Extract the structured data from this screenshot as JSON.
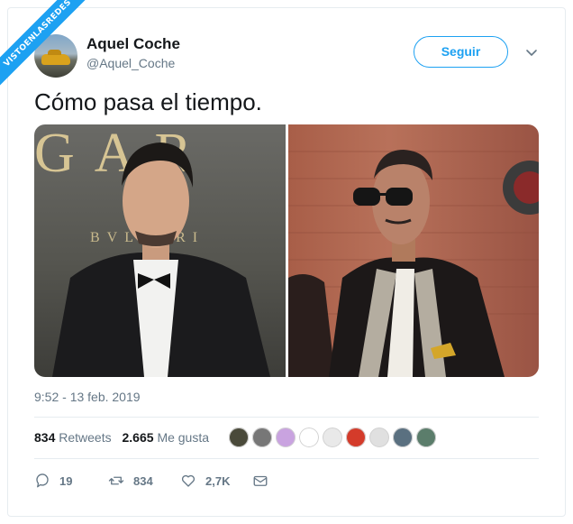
{
  "watermark": {
    "text": "VISTOENLASREDES"
  },
  "user": {
    "name": "Aquel Coche",
    "handle": "@Aquel_Coche",
    "avatar_icon": "avatar-car-icon"
  },
  "follow_button": {
    "label": "Seguir"
  },
  "tweet": {
    "text": "Cómo pasa el tiempo.",
    "timestamp": "9:52 - 13 feb. 2019"
  },
  "media": {
    "photos": [
      {
        "name": "photo-left",
        "sign_letters": "GAR",
        "sign_small": "BVLGARI"
      },
      {
        "name": "photo-right"
      }
    ]
  },
  "stats": {
    "retweets_count": "834",
    "retweets_label": "Retweets",
    "likes_count": "2.665",
    "likes_label": "Me gusta"
  },
  "likers": [
    {
      "color": "#4a4a3a"
    },
    {
      "color": "#777777"
    },
    {
      "color": "#c9a3e0"
    },
    {
      "color": "#ffffff"
    },
    {
      "color": "#e9e9e9"
    },
    {
      "color": "#d43b2a"
    },
    {
      "color": "#e0e0e0"
    },
    {
      "color": "#5a7080"
    },
    {
      "color": "#5b7d6b"
    }
  ],
  "actions": {
    "reply_count": "19",
    "retweet_count": "834",
    "like_count": "2,7K"
  },
  "colors": {
    "accent": "#1da1f2",
    "secondary_text": "#657786",
    "border": "#e6ecf0"
  }
}
